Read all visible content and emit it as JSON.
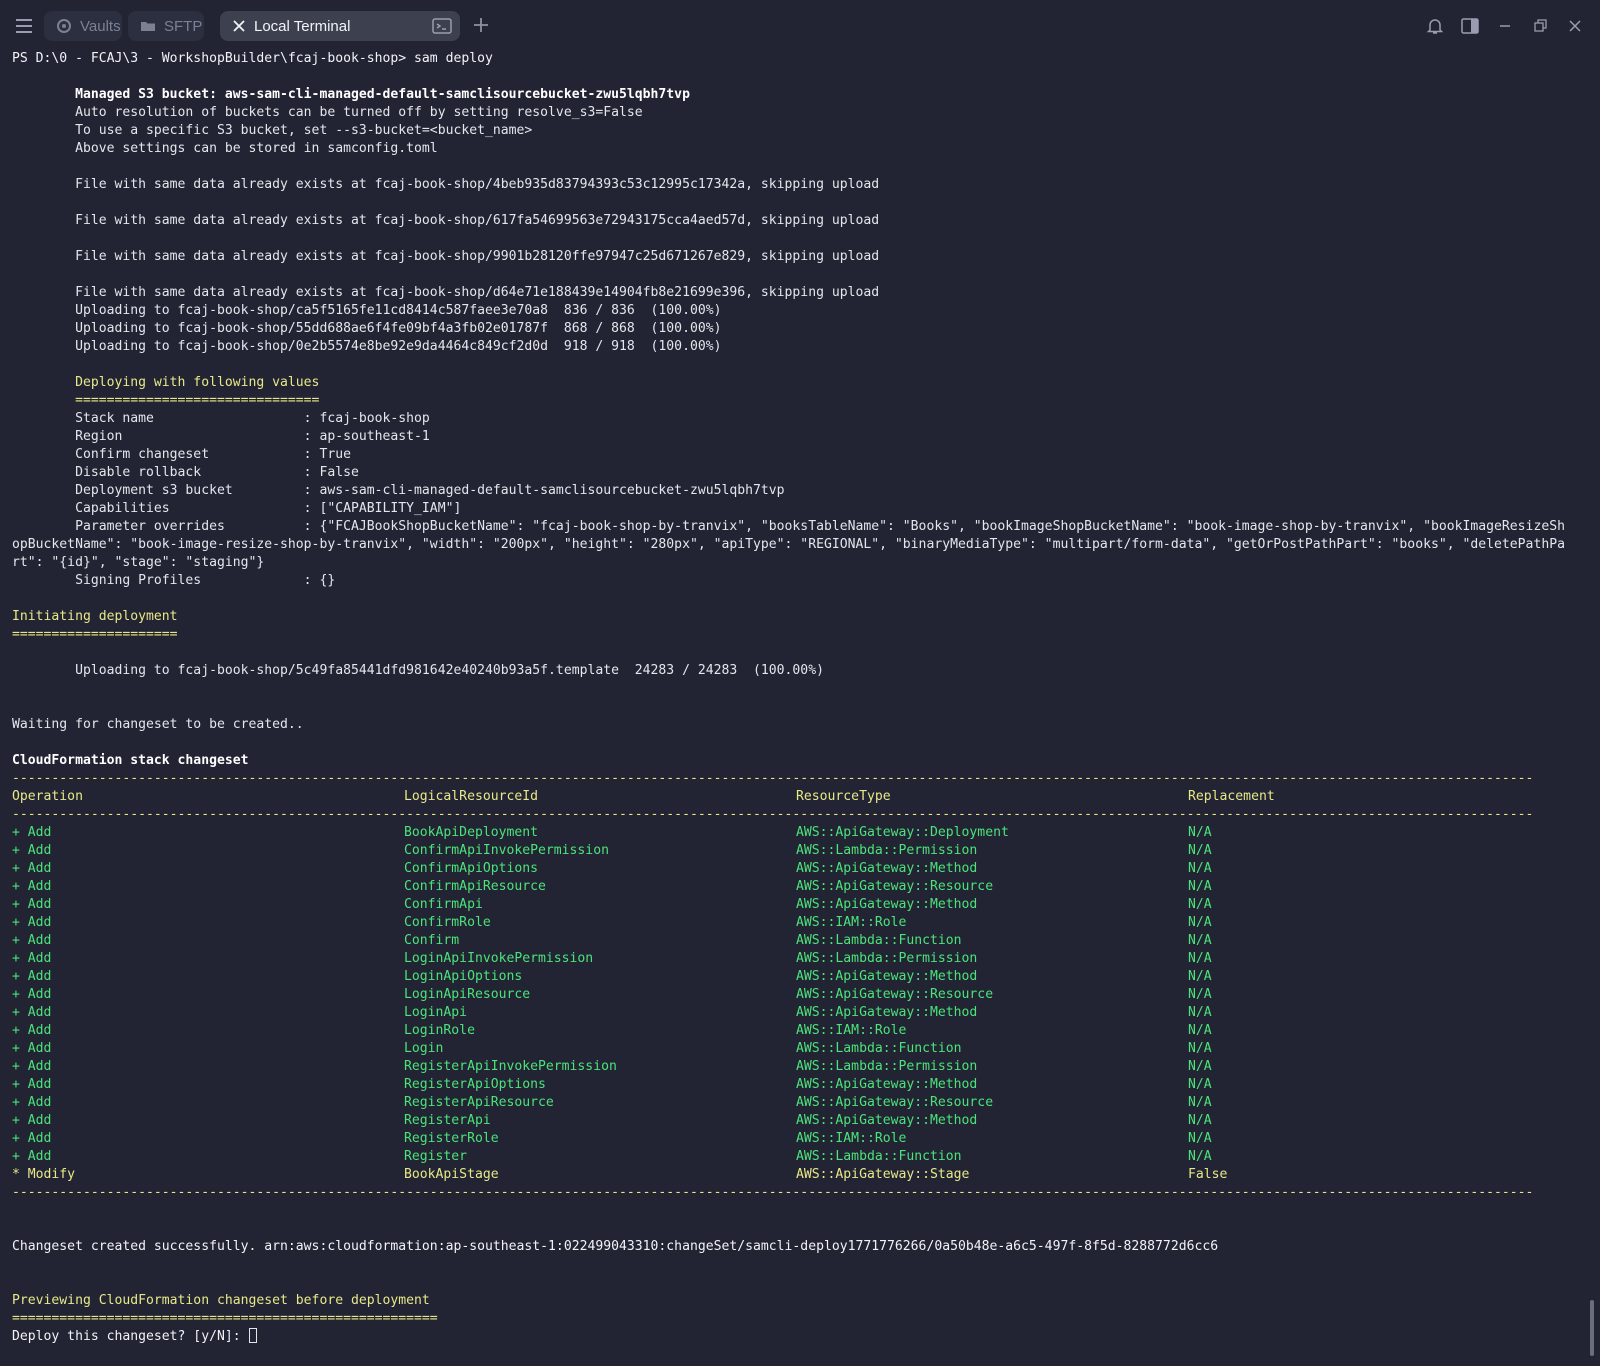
{
  "tabs": [
    {
      "label": "Vaults",
      "icon": "vault-icon"
    },
    {
      "label": "SFTP",
      "icon": "folder-icon"
    },
    {
      "label": "Local Terminal",
      "icon": "close-icon",
      "active": true
    }
  ],
  "window": {
    "controls": [
      "bell-icon",
      "split-view-icon",
      "minimize-icon",
      "restore-icon",
      "close-icon"
    ]
  },
  "terminal": {
    "prompt_line": "PS D:\\0 - FCAJ\\3 - WorkshopBuilder\\fcaj-book-shop> sam deploy",
    "s3_bucket_line": "        Managed S3 bucket: aws-sam-cli-managed-default-samclisourcebucket-zwu5lqbh7tvp",
    "s3_info": [
      "        Auto resolution of buckets can be turned off by setting resolve_s3=False",
      "        To use a specific S3 bucket, set --s3-bucket=<bucket_name>",
      "        Above settings can be stored in samconfig.toml"
    ],
    "file_exists": [
      "        File with same data already exists at fcaj-book-shop/4beb935d83794393c53c12995c17342a, skipping upload",
      "        File with same data already exists at fcaj-book-shop/617fa54699563e72943175cca4aed57d, skipping upload",
      "        File with same data already exists at fcaj-book-shop/9901b28120ffe97947c25d671267e829, skipping upload",
      "        File with same data already exists at fcaj-book-shop/d64e71e188439e14904fb8e21699e396, skipping upload"
    ],
    "uploads": [
      "        Uploading to fcaj-book-shop/ca5f5165fe11cd8414c587faee3e70a8  836 / 836  (100.00%)",
      "        Uploading to fcaj-book-shop/55dd688ae6f4fe09bf4a3fb02e01787f  868 / 868  (100.00%)",
      "        Uploading to fcaj-book-shop/0e2b5574e8be92e9da4464c849cf2d0d  918 / 918  (100.00%)"
    ],
    "deploy_values_title": "        Deploying with following values",
    "deploy_values_rule": "        ===============================",
    "deploy_values": [
      "        Stack name                   : fcaj-book-shop",
      "        Region                       : ap-southeast-1",
      "        Confirm changeset            : True",
      "        Disable rollback             : False",
      "        Deployment s3 bucket         : aws-sam-cli-managed-default-samclisourcebucket-zwu5lqbh7tvp",
      "        Capabilities                 : [\"CAPABILITY_IAM\"]",
      "        Parameter overrides          : {\"FCAJBookShopBucketName\": \"fcaj-book-shop-by-tranvix\", \"booksTableName\": \"Books\", \"bookImageShopBucketName\": \"book-image-shop-by-tranvix\", \"bookImageResizeSh",
      "opBucketName\": \"book-image-resize-shop-by-tranvix\", \"width\": \"200px\", \"height\": \"280px\", \"apiType\": \"REGIONAL\", \"binaryMediaType\": \"multipart/form-data\", \"getOrPostPathPart\": \"books\", \"deletePathPa",
      "rt\": \"{id}\", \"stage\": \"staging\"}",
      "        Signing Profiles             : {}"
    ],
    "initiating_title": "Initiating deployment",
    "initiating_rule": "=====================",
    "template_upload": "        Uploading to fcaj-book-shop/5c49fa85441dfd981642e40240b93a5f.template  24283 / 24283  (100.00%)",
    "waiting": "Waiting for changeset to be created..",
    "changeset_title": "CloudFormation stack changeset",
    "dash_rule": "-------------------------------------------------------------------------------------------------------------------------------------------------------------------------------------------------",
    "table_headers": [
      "Operation",
      "LogicalResourceId",
      "ResourceType",
      "Replacement"
    ],
    "table_rows": [
      [
        "+ Add",
        "BookApiDeployment",
        "AWS::ApiGateway::Deployment",
        "N/A"
      ],
      [
        "+ Add",
        "ConfirmApiInvokePermission",
        "AWS::Lambda::Permission",
        "N/A"
      ],
      [
        "+ Add",
        "ConfirmApiOptions",
        "AWS::ApiGateway::Method",
        "N/A"
      ],
      [
        "+ Add",
        "ConfirmApiResource",
        "AWS::ApiGateway::Resource",
        "N/A"
      ],
      [
        "+ Add",
        "ConfirmApi",
        "AWS::ApiGateway::Method",
        "N/A"
      ],
      [
        "+ Add",
        "ConfirmRole",
        "AWS::IAM::Role",
        "N/A"
      ],
      [
        "+ Add",
        "Confirm",
        "AWS::Lambda::Function",
        "N/A"
      ],
      [
        "+ Add",
        "LoginApiInvokePermission",
        "AWS::Lambda::Permission",
        "N/A"
      ],
      [
        "+ Add",
        "LoginApiOptions",
        "AWS::ApiGateway::Method",
        "N/A"
      ],
      [
        "+ Add",
        "LoginApiResource",
        "AWS::ApiGateway::Resource",
        "N/A"
      ],
      [
        "+ Add",
        "LoginApi",
        "AWS::ApiGateway::Method",
        "N/A"
      ],
      [
        "+ Add",
        "LoginRole",
        "AWS::IAM::Role",
        "N/A"
      ],
      [
        "+ Add",
        "Login",
        "AWS::Lambda::Function",
        "N/A"
      ],
      [
        "+ Add",
        "RegisterApiInvokePermission",
        "AWS::Lambda::Permission",
        "N/A"
      ],
      [
        "+ Add",
        "RegisterApiOptions",
        "AWS::ApiGateway::Method",
        "N/A"
      ],
      [
        "+ Add",
        "RegisterApiResource",
        "AWS::ApiGateway::Resource",
        "N/A"
      ],
      [
        "+ Add",
        "RegisterApi",
        "AWS::ApiGateway::Method",
        "N/A"
      ],
      [
        "+ Add",
        "RegisterRole",
        "AWS::IAM::Role",
        "N/A"
      ],
      [
        "+ Add",
        "Register",
        "AWS::Lambda::Function",
        "N/A"
      ],
      [
        "* Modify",
        "BookApiStage",
        "AWS::ApiGateway::Stage",
        "False"
      ]
    ],
    "changeset_created": "Changeset created successfully. arn:aws:cloudformation:ap-southeast-1:022499043310:changeSet/samcli-deploy1771776266/0a50b48e-a6c5-497f-8f5d-8288772d6cc6",
    "preview_title": "Previewing CloudFormation changeset before deployment",
    "preview_rule": "======================================================",
    "confirm_prompt": "Deploy this changeset? [y/N]: "
  },
  "colors": {
    "background": "#222433",
    "green": "#4be37a",
    "yellow": "#e8e889",
    "text": "#e4e6ec"
  }
}
